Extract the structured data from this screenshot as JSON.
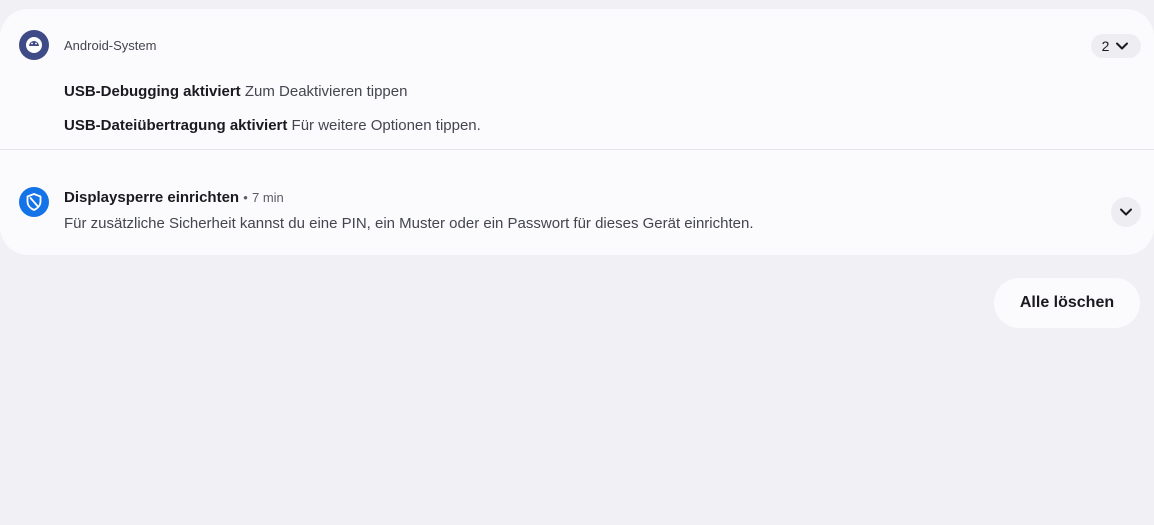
{
  "android_group": {
    "app_name": "Android-System",
    "count": "2",
    "icon": "android-system-icon",
    "items": [
      {
        "title": "USB-Debugging aktiviert",
        "body": "Zum Deaktivieren tippen"
      },
      {
        "title": "USB-Dateiübertragung aktiviert",
        "body": "Für weitere Optionen tippen."
      }
    ]
  },
  "screen_lock": {
    "title": "Displaysperre einrichten",
    "separator": "•",
    "time": "7 min",
    "body": "Für zusätzliche Sicherheit kannst du eine PIN, ein Muster oder ein Passwort für dieses Gerät einrichten.",
    "icon": "shield-icon"
  },
  "clear_all_label": "Alle löschen",
  "colors": {
    "background": "#f1f0f4",
    "card": "#fbfafd",
    "android_icon_bg": "#3e4b86",
    "shield_icon_bg": "#1473e6"
  }
}
